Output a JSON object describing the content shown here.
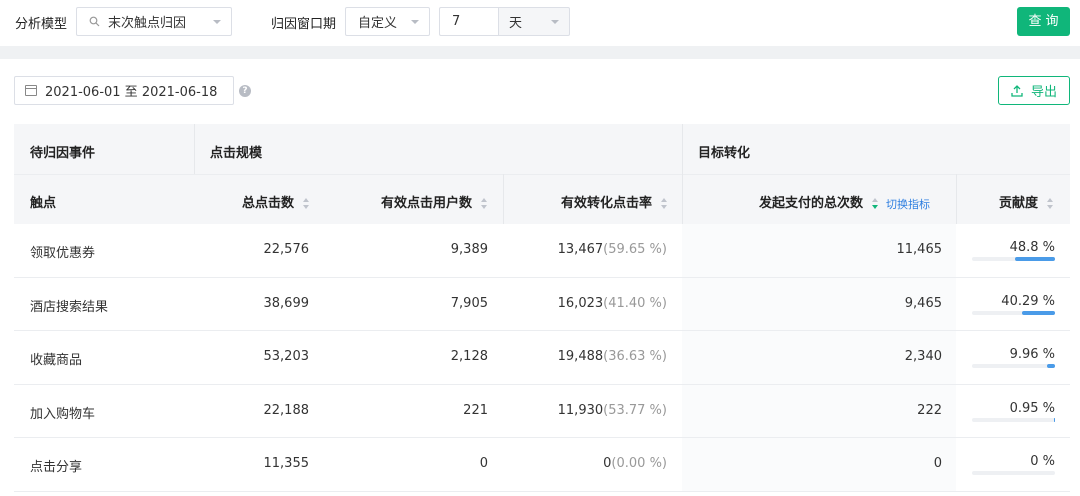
{
  "filters": {
    "model_label": "分析模型",
    "model_value": "末次触点归因",
    "window_label": "归因窗口期",
    "window_mode": "自定义",
    "window_value": "7",
    "window_unit": "天",
    "query_label": "查询"
  },
  "date_range": "2021-06-01 至 2021-06-18",
  "help_glyph": "?",
  "export_label": "导出",
  "table": {
    "group_headers": [
      "待归因事件",
      "点击规模",
      "目标转化"
    ],
    "columns": [
      "触点",
      "总点击数",
      "有效点击用户数",
      "有效转化点击率",
      "发起支付的总次数",
      "贡献度"
    ],
    "switch_metric_label": "切换指标",
    "rows": [
      {
        "touchpoint": "领取优惠券",
        "clicks": "22,576",
        "users": "9,389",
        "conv": "13,467",
        "conv_pct": "(59.65 %)",
        "payments": "11,465",
        "contrib": "48.8 %",
        "contrib_value": 48.8
      },
      {
        "touchpoint": "酒店搜索结果",
        "clicks": "38,699",
        "users": "7,905",
        "conv": "16,023",
        "conv_pct": "(41.40 %)",
        "payments": "9,465",
        "contrib": "40.29 %",
        "contrib_value": 40.29
      },
      {
        "touchpoint": "收藏商品",
        "clicks": "53,203",
        "users": "2,128",
        "conv": "19,488",
        "conv_pct": "(36.63 %)",
        "payments": "2,340",
        "contrib": "9.96 %",
        "contrib_value": 9.96
      },
      {
        "touchpoint": "加入购物车",
        "clicks": "22,188",
        "users": "221",
        "conv": "11,930",
        "conv_pct": "(53.77 %)",
        "payments": "222",
        "contrib": "0.95 %",
        "contrib_value": 0.95
      },
      {
        "touchpoint": "点击分享",
        "clicks": "11,355",
        "users": "0",
        "conv": "0",
        "conv_pct": "(0.00 %)",
        "payments": "0",
        "contrib": "0 %",
        "contrib_value": 0
      }
    ]
  },
  "colors": {
    "accent": "#10b67a",
    "bar": "#4a9be8",
    "link": "#2f7fe0"
  },
  "icons": [
    "search-icon",
    "chevron-down-icon",
    "calendar-icon",
    "help-icon",
    "upload-icon",
    "sort-icon"
  ]
}
